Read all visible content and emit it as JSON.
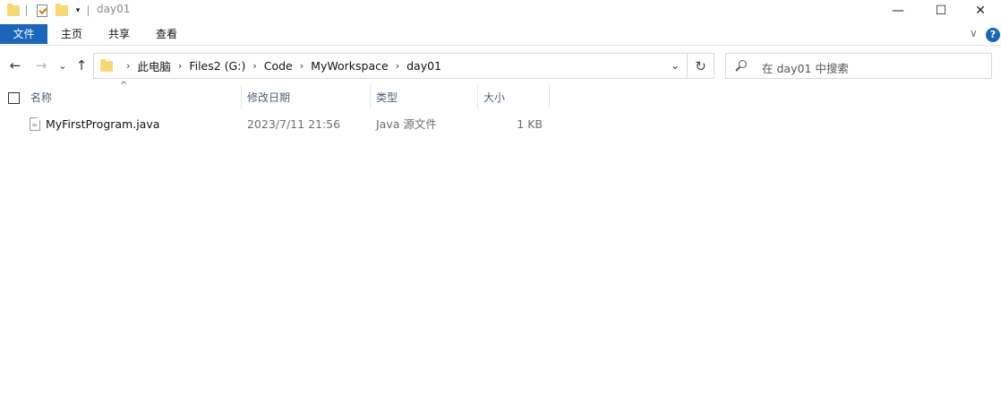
{
  "window": {
    "title": "day01",
    "minimize_glyph": "—",
    "maximize_glyph": "☐",
    "close_glyph": "✕"
  },
  "quick_access": {
    "dropdown_glyph": "▾"
  },
  "ribbon": {
    "tabs": [
      {
        "label": "文件"
      },
      {
        "label": "主页"
      },
      {
        "label": "共享"
      },
      {
        "label": "查看"
      }
    ],
    "expand_glyph": "∨",
    "help_glyph": "?"
  },
  "navigation": {
    "back_glyph": "←",
    "forward_glyph": "→",
    "recent_glyph": "⌄",
    "up_glyph": "↑",
    "breadcrumb": [
      "此电脑",
      "Files2 (G:)",
      "Code",
      "MyWorkspace",
      "day01"
    ],
    "separator_glyph": "›",
    "dropdown_glyph": "⌄",
    "refresh_glyph": "↻"
  },
  "search": {
    "placeholder": "在 day01 中搜索"
  },
  "columns": {
    "name": "名称",
    "modified": "修改日期",
    "type": "类型",
    "size": "大小",
    "sort_glyph": "^"
  },
  "files": [
    {
      "name": "MyFirstProgram.java",
      "modified": "2023/7/11 21:56",
      "type": "Java 源文件",
      "size": "1 KB"
    }
  ]
}
